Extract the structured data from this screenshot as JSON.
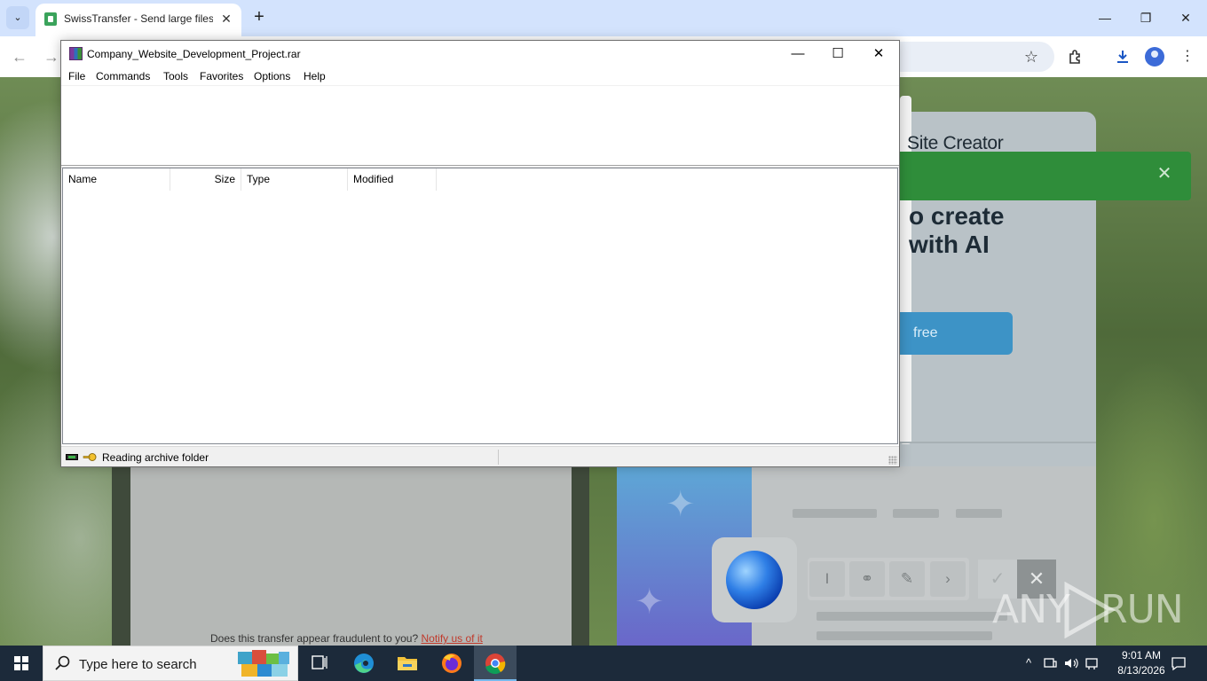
{
  "browser": {
    "tab_title": "SwissTransfer - Send large files",
    "tab_close": "✕",
    "new_tab": "+",
    "tab_list": "⌄",
    "window_controls": {
      "minimize": "—",
      "restore": "❐",
      "close": "✕"
    }
  },
  "background_page": {
    "card_title": "Site Creator",
    "card_headline_line1": "o create",
    "card_headline_line2": "with AI",
    "card_cta": "free",
    "banner_close": "✕",
    "fraud_question": "Does this transfer appear fraudulent to you?",
    "fraud_link": "Notify us of it",
    "format_buttons": [
      "I",
      "⚭",
      "✎",
      "›"
    ],
    "ok_symbol": "✓",
    "cancel_symbol": "✕"
  },
  "watermark": {
    "left": "ANY",
    "right": "RUN"
  },
  "winrar": {
    "title": "Company_Website_Development_Project.rar",
    "window_controls": {
      "minimize": "—",
      "maximize": "☐",
      "close": "✕"
    },
    "menu": [
      "File",
      "Commands",
      "Tools",
      "Favorites",
      "Options",
      "Help"
    ],
    "columns": [
      "Name",
      "Size",
      "Type",
      "Modified"
    ],
    "status_text": "Reading archive folder"
  },
  "taskbar": {
    "search_placeholder": "Type here to search",
    "clock_time": "9:01 AM",
    "clock_date": "8/13/2026",
    "tray_chevron": "^"
  },
  "colors": {
    "chrome_tab_bar": "#d3e3fd",
    "taskbar": "#1c2a3a",
    "green_banner": "#2f8d3a",
    "cta_blue": "#3d93c6",
    "fraud_link": "#c0392b"
  }
}
